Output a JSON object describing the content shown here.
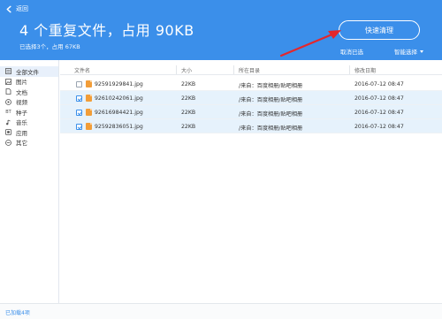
{
  "header": {
    "back_label": "返回",
    "title": "4 个重复文件，占用 90KB",
    "subtitle": "已选择3个，占用 67KB",
    "quick_clean_label": "快速清理",
    "cancel_selected_label": "取消已选",
    "smart_select_label": "智能选择"
  },
  "sidebar": {
    "items": [
      {
        "label": "全部文件",
        "icon": "all-files-icon"
      },
      {
        "label": "图片",
        "icon": "image-icon"
      },
      {
        "label": "文档",
        "icon": "document-icon"
      },
      {
        "label": "视频",
        "icon": "video-icon"
      },
      {
        "label": "种子",
        "icon": "bt-icon",
        "icon_text": "BT"
      },
      {
        "label": "音乐",
        "icon": "music-icon"
      },
      {
        "label": "应用",
        "icon": "app-icon"
      },
      {
        "label": "其它",
        "icon": "other-icon"
      }
    ]
  },
  "table": {
    "columns": [
      "文件名",
      "大小",
      "所在目录",
      "修改日期"
    ],
    "rows": [
      {
        "checked": false,
        "name": "92591929841.jpg",
        "size": "22KB",
        "dir": "/来自：百度相册/贴吧相册",
        "date": "2016-07-12 08:47"
      },
      {
        "checked": true,
        "name": "92610242061.jpg",
        "size": "22KB",
        "dir": "/来自：百度相册/贴吧相册",
        "date": "2016-07-12 08:47"
      },
      {
        "checked": true,
        "name": "92616984421.jpg",
        "size": "22KB",
        "dir": "/来自：百度相册/贴吧相册",
        "date": "2016-07-12 08:47"
      },
      {
        "checked": true,
        "name": "92592836051.jpg",
        "size": "22KB",
        "dir": "/来自：百度相册/贴吧相册",
        "date": "2016-07-12 08:47"
      }
    ]
  },
  "status": {
    "text": "已加载4项"
  },
  "colors": {
    "header_bg": "#3b8fea",
    "selected_row_bg": "#e6f2fc",
    "file_icon": "#f29d38",
    "annotation_arrow": "#e5262b"
  }
}
